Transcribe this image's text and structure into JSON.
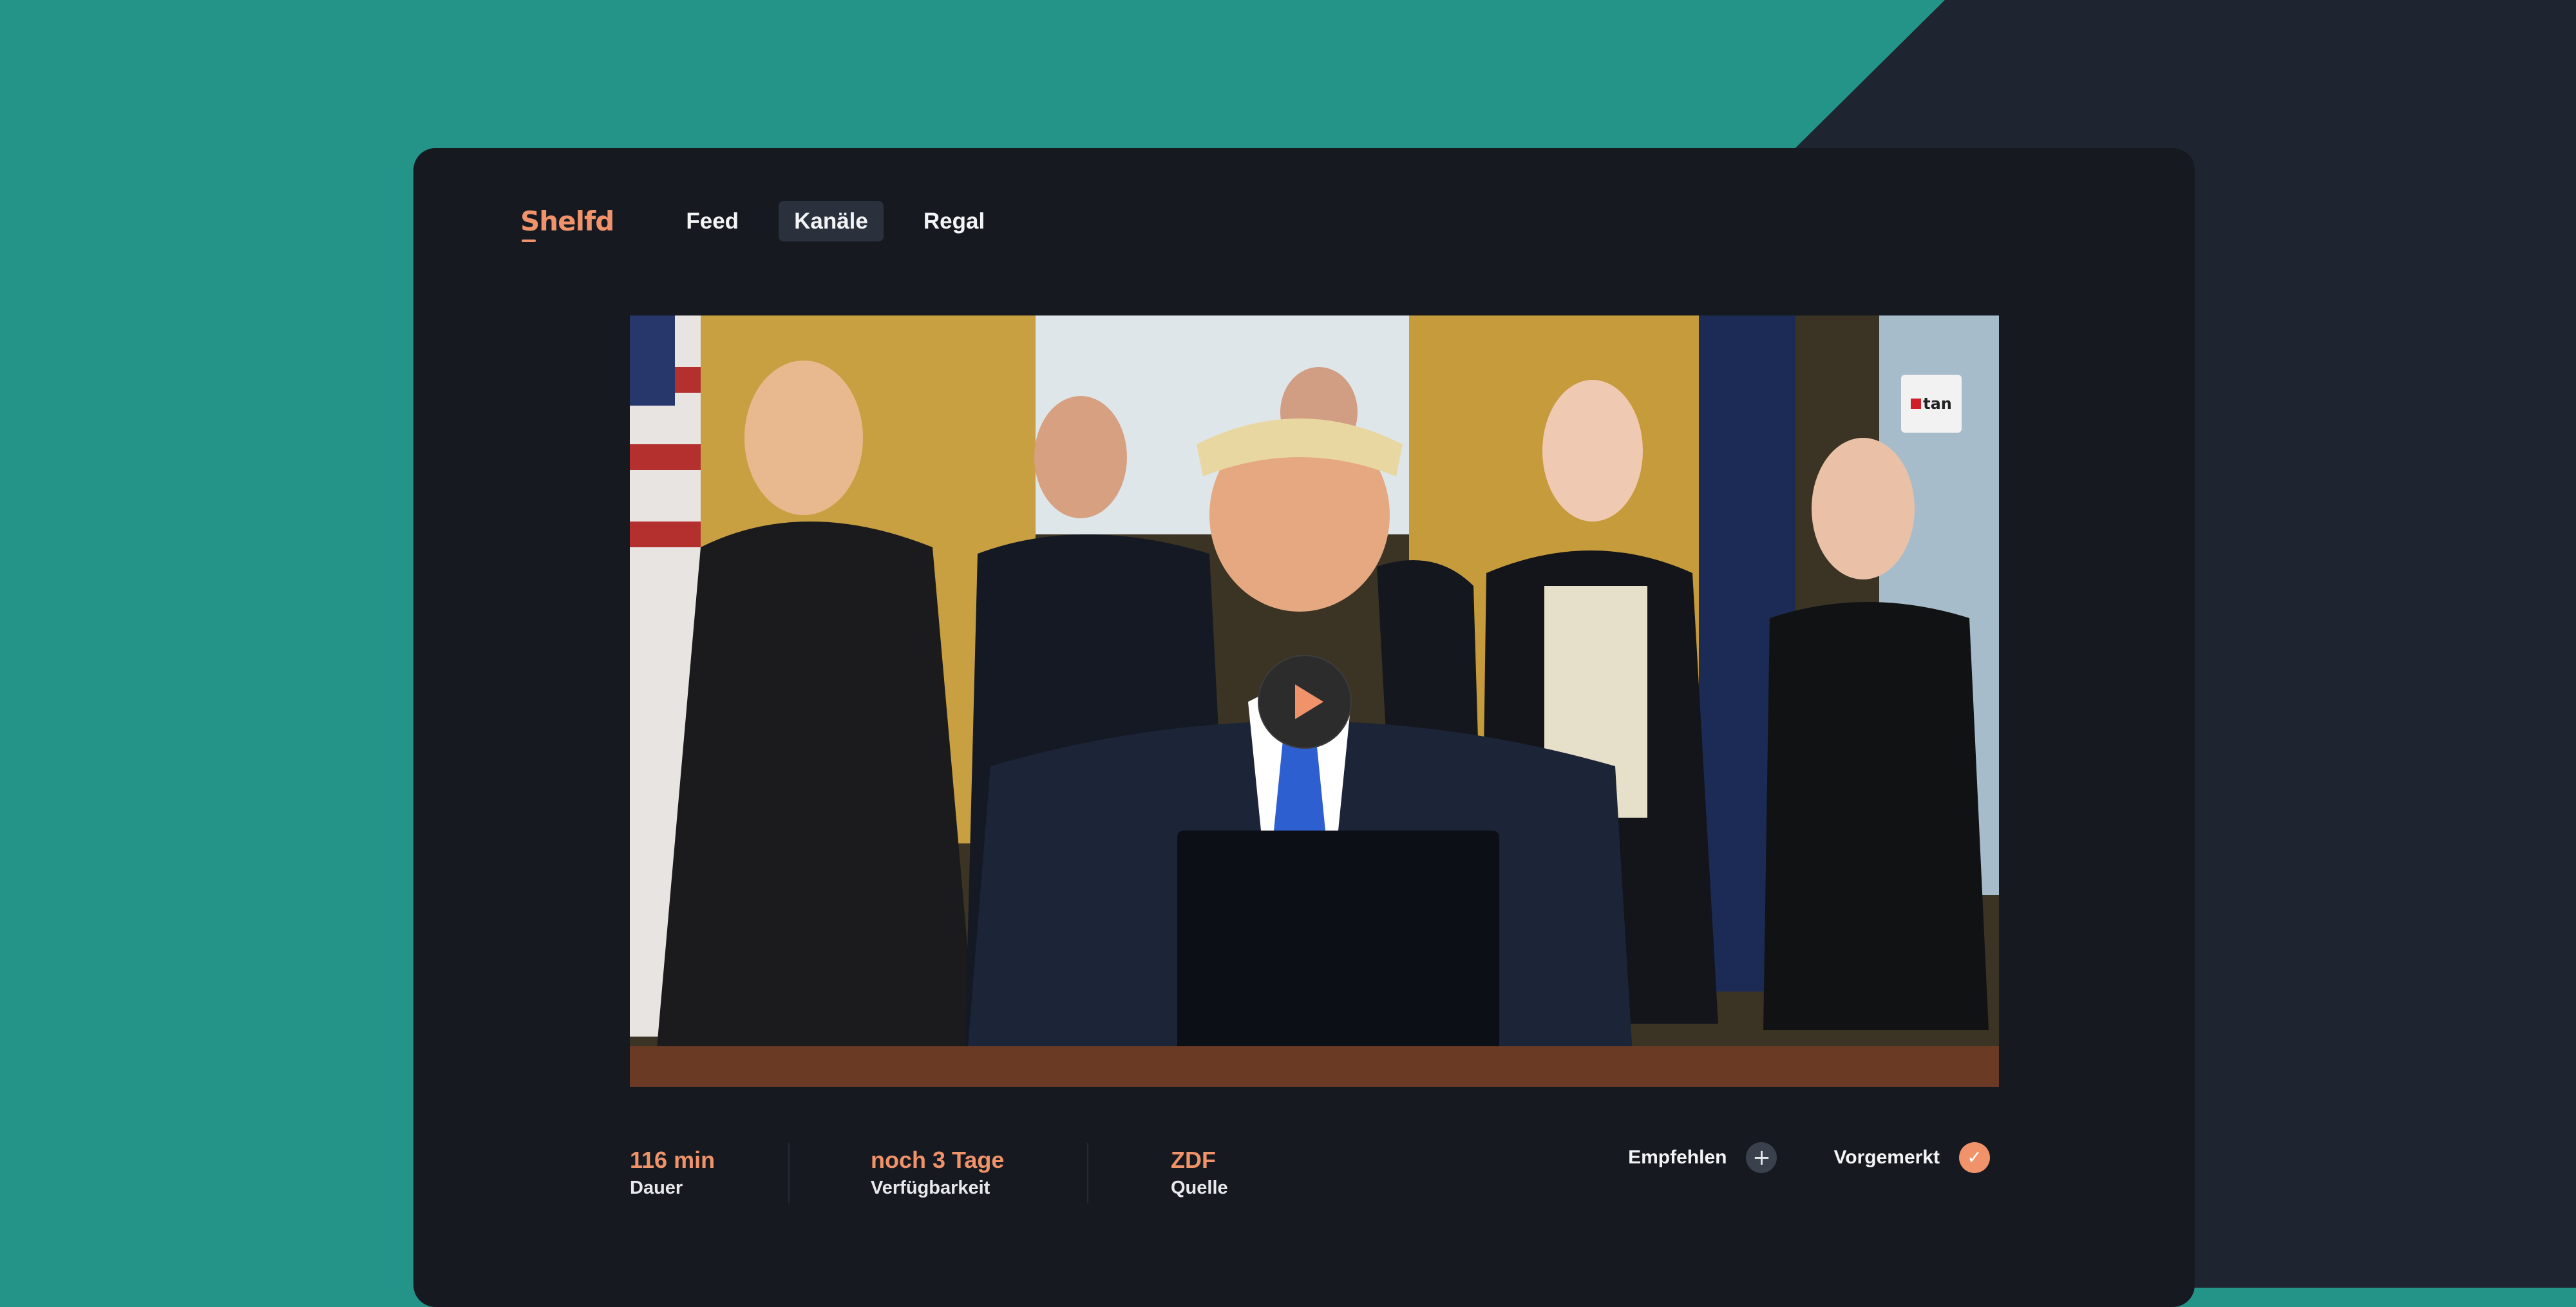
{
  "app": {
    "logo": "Shelfd"
  },
  "nav": {
    "items": [
      {
        "label": "Feed",
        "active": false
      },
      {
        "label": "Kanäle",
        "active": true
      },
      {
        "label": "Regal",
        "active": false
      }
    ]
  },
  "player": {
    "channel_logo": "tan",
    "play_icon": "play-icon"
  },
  "meta": {
    "stats": [
      {
        "value": "116 min",
        "label": "Dauer"
      },
      {
        "value": "noch 3 Tage",
        "label": "Verfügbarkeit"
      },
      {
        "value": "ZDF",
        "label": "Quelle"
      }
    ]
  },
  "actions": {
    "recommend": {
      "label": "Empfehlen",
      "icon": "plus-icon"
    },
    "bookmarked": {
      "label": "Vorgemerkt",
      "icon": "check-icon"
    }
  },
  "colors": {
    "accent": "#f0926a",
    "teal": "#249489",
    "panel": "#161a20",
    "page_dark": "#1e2530"
  }
}
